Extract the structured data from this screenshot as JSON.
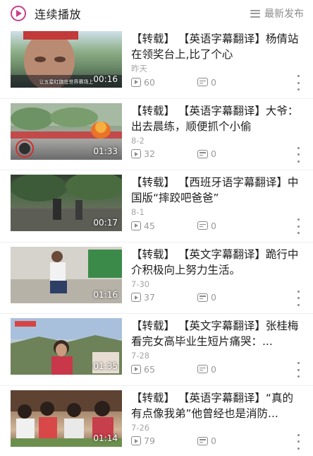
{
  "header": {
    "title": "连续播放",
    "sort_label": "最新发布"
  },
  "colors": {
    "accent": "#c9408a",
    "text_primary": "#1e1e1e",
    "text_secondary": "#a6a6a6"
  },
  "videos": [
    {
      "title": "【转载】 【英语字幕翻译】杨倩站在领奖台上,比了个心",
      "date": "昨天",
      "duration": "00:16",
      "views": "60",
      "comments": "0",
      "caption": "让五星红旗在世界赛场上"
    },
    {
      "title": "【转载】 【英语字幕翻译】大爷：出去晨练，顺便抓个小偷",
      "date": "8-2",
      "duration": "01:33",
      "views": "32",
      "comments": "0",
      "caption": ""
    },
    {
      "title": "【转载】 【西班牙语字幕翻译】中国版“摔跤吧爸爸”",
      "date": "8-1",
      "duration": "00:17",
      "views": "45",
      "comments": "0",
      "caption": ""
    },
    {
      "title": "【转载】 【英文字幕翻译】跪行中介积极向上努力生活。",
      "date": "7-30",
      "duration": "01:16",
      "views": "37",
      "comments": "0",
      "caption": ""
    },
    {
      "title": "【转载】 【英文字幕翻译】张桂梅看完女高毕业生短片痛哭：...",
      "date": "7-28",
      "duration": "01:35",
      "views": "65",
      "comments": "0",
      "caption": ""
    },
    {
      "title": "【转载】 【英语字幕翻译】“真的有点像我弟”他曾经也是消防...",
      "date": "7-26",
      "duration": "01:14",
      "views": "79",
      "comments": "0",
      "caption": ""
    }
  ]
}
